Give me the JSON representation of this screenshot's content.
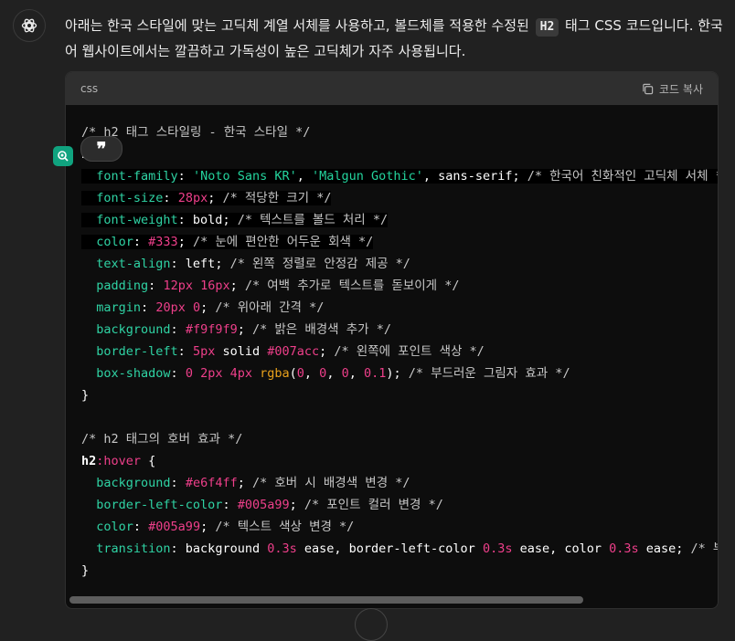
{
  "message": {
    "text_before": "아래는 한국 스타일에 맞는 고딕체 계열 서체를 사용하고, 볼드체를 적용한 수정된 ",
    "inline_code": "H2",
    "text_after": " 태그 CSS 코드입니다. 한국어 웹사이트에서는 깔끔하고 가독성이 높은 고딕체가 자주 사용됩니다."
  },
  "code_block": {
    "language": "css",
    "copy_label": "코드 복사",
    "lines": [
      [
        {
          "t": "com",
          "v": "/* h2 태그 스타일링 - 한국 스타일 */"
        }
      ],
      [
        {
          "t": "sel",
          "v": "h2"
        },
        {
          "t": "val",
          "v": " {"
        }
      ],
      [
        {
          "t": "val",
          "v": "  "
        },
        {
          "t": "prop",
          "v": "font-family"
        },
        {
          "t": "val",
          "v": ": "
        },
        {
          "t": "str",
          "v": "'Noto Sans KR'"
        },
        {
          "t": "val",
          "v": ", "
        },
        {
          "t": "str",
          "v": "'Malgun Gothic'"
        },
        {
          "t": "val",
          "v": ", sans-serif; "
        },
        {
          "t": "com",
          "v": "/* 한국어 친화적인 고딕체 서체 */"
        }
      ],
      [
        {
          "t": "val",
          "v": "  "
        },
        {
          "t": "prop",
          "v": "font-size"
        },
        {
          "t": "val",
          "v": ": "
        },
        {
          "t": "num",
          "v": "28px"
        },
        {
          "t": "val",
          "v": "; "
        },
        {
          "t": "com",
          "v": "/* 적당한 크기 */"
        }
      ],
      [
        {
          "t": "val",
          "v": "  "
        },
        {
          "t": "prop",
          "v": "font-weight"
        },
        {
          "t": "val",
          "v": ": bold; "
        },
        {
          "t": "com",
          "v": "/* 텍스트를 볼드 처리 */"
        }
      ],
      [
        {
          "t": "val",
          "v": "  "
        },
        {
          "t": "prop",
          "v": "color"
        },
        {
          "t": "val",
          "v": ": "
        },
        {
          "t": "num",
          "v": "#333"
        },
        {
          "t": "val",
          "v": "; "
        },
        {
          "t": "com",
          "v": "/* 눈에 편안한 어두운 회색 */"
        }
      ],
      [
        {
          "t": "val",
          "v": "  "
        },
        {
          "t": "prop",
          "v": "text-align"
        },
        {
          "t": "val",
          "v": ": left; "
        },
        {
          "t": "com",
          "v": "/* 왼쪽 정렬로 안정감 제공 */"
        }
      ],
      [
        {
          "t": "val",
          "v": "  "
        },
        {
          "t": "prop",
          "v": "padding"
        },
        {
          "t": "val",
          "v": ": "
        },
        {
          "t": "num",
          "v": "12px 16px"
        },
        {
          "t": "val",
          "v": "; "
        },
        {
          "t": "com",
          "v": "/* 여백 추가로 텍스트를 돋보이게 */"
        }
      ],
      [
        {
          "t": "val",
          "v": "  "
        },
        {
          "t": "prop",
          "v": "margin"
        },
        {
          "t": "val",
          "v": ": "
        },
        {
          "t": "num",
          "v": "20px 0"
        },
        {
          "t": "val",
          "v": "; "
        },
        {
          "t": "com",
          "v": "/* 위아래 간격 */"
        }
      ],
      [
        {
          "t": "val",
          "v": "  "
        },
        {
          "t": "prop",
          "v": "background"
        },
        {
          "t": "val",
          "v": ": "
        },
        {
          "t": "num",
          "v": "#f9f9f9"
        },
        {
          "t": "val",
          "v": "; "
        },
        {
          "t": "com",
          "v": "/* 밝은 배경색 추가 */"
        }
      ],
      [
        {
          "t": "val",
          "v": "  "
        },
        {
          "t": "prop",
          "v": "border-left"
        },
        {
          "t": "val",
          "v": ": "
        },
        {
          "t": "num",
          "v": "5px"
        },
        {
          "t": "val",
          "v": " solid "
        },
        {
          "t": "num",
          "v": "#007acc"
        },
        {
          "t": "val",
          "v": "; "
        },
        {
          "t": "com",
          "v": "/* 왼쪽에 포인트 색상 */"
        }
      ],
      [
        {
          "t": "val",
          "v": "  "
        },
        {
          "t": "prop",
          "v": "box-shadow"
        },
        {
          "t": "val",
          "v": ": "
        },
        {
          "t": "num",
          "v": "0 2px 4px"
        },
        {
          "t": "val",
          "v": " "
        },
        {
          "t": "fn",
          "v": "rgba"
        },
        {
          "t": "val",
          "v": "("
        },
        {
          "t": "num",
          "v": "0"
        },
        {
          "t": "val",
          "v": ", "
        },
        {
          "t": "num",
          "v": "0"
        },
        {
          "t": "val",
          "v": ", "
        },
        {
          "t": "num",
          "v": "0"
        },
        {
          "t": "val",
          "v": ", "
        },
        {
          "t": "num",
          "v": "0.1"
        },
        {
          "t": "val",
          "v": "); "
        },
        {
          "t": "com",
          "v": "/* 부드러운 그림자 효과 */"
        }
      ],
      [
        {
          "t": "val",
          "v": "}"
        }
      ],
      [
        {
          "t": "val",
          "v": ""
        }
      ],
      [
        {
          "t": "com",
          "v": "/* h2 태그의 호버 효과 */"
        }
      ],
      [
        {
          "t": "sel",
          "v": "h2"
        },
        {
          "t": "pseudo",
          "v": ":hover"
        },
        {
          "t": "val",
          "v": " {"
        }
      ],
      [
        {
          "t": "val",
          "v": "  "
        },
        {
          "t": "prop",
          "v": "background"
        },
        {
          "t": "val",
          "v": ": "
        },
        {
          "t": "num",
          "v": "#e6f4ff"
        },
        {
          "t": "val",
          "v": "; "
        },
        {
          "t": "com",
          "v": "/* 호버 시 배경색 변경 */"
        }
      ],
      [
        {
          "t": "val",
          "v": "  "
        },
        {
          "t": "prop",
          "v": "border-left-color"
        },
        {
          "t": "val",
          "v": ": "
        },
        {
          "t": "num",
          "v": "#005a99"
        },
        {
          "t": "val",
          "v": "; "
        },
        {
          "t": "com",
          "v": "/* 포인트 컬러 변경 */"
        }
      ],
      [
        {
          "t": "val",
          "v": "  "
        },
        {
          "t": "prop",
          "v": "color"
        },
        {
          "t": "val",
          "v": ": "
        },
        {
          "t": "num",
          "v": "#005a99"
        },
        {
          "t": "val",
          "v": "; "
        },
        {
          "t": "com",
          "v": "/* 텍스트 색상 변경 */"
        }
      ],
      [
        {
          "t": "val",
          "v": "  "
        },
        {
          "t": "prop",
          "v": "transition"
        },
        {
          "t": "val",
          "v": ": background "
        },
        {
          "t": "num",
          "v": "0.3s"
        },
        {
          "t": "val",
          "v": " ease, border-left-color "
        },
        {
          "t": "num",
          "v": "0.3s"
        },
        {
          "t": "val",
          "v": " ease, color "
        },
        {
          "t": "num",
          "v": "0.3s"
        },
        {
          "t": "val",
          "v": " ease; "
        },
        {
          "t": "com",
          "v": "/* 부드러운 전환 효과 */"
        }
      ],
      [
        {
          "t": "val",
          "v": "}"
        }
      ]
    ]
  },
  "highlighted_lines": [
    2,
    3,
    4,
    5
  ],
  "quote_button": {
    "label": "❞"
  }
}
